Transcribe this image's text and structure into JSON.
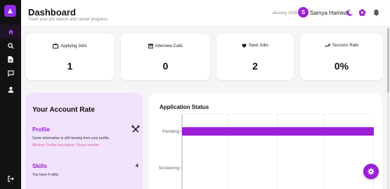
{
  "header": {
    "title": "Dashboard",
    "subtitle": "Track your job search and career progress",
    "date": "January 2026",
    "user_initial": "S",
    "user_name": "Samya Hamed"
  },
  "sidebar": {
    "icons": [
      "home-icon",
      "search-icon",
      "document-icon",
      "chat-icon",
      "user-icon",
      "logout-icon"
    ],
    "active": "home-icon"
  },
  "stats": [
    {
      "label": "Applying Jobs",
      "icon": "briefcase-icon",
      "value": "1"
    },
    {
      "label": "Interview Calls",
      "icon": "calendar-icon",
      "value": "0"
    },
    {
      "label": "Save Jobs",
      "icon": "heart-icon",
      "value": "2"
    },
    {
      "label": "Success Rate",
      "icon": "trend-up-icon",
      "value": "0%"
    }
  ],
  "account": {
    "title": "Your Account Rate",
    "profile_label": "Profile",
    "profile_text": "Some information is still missing from your profile.",
    "profile_missing": "Missing: Profile description, Phone number",
    "skills_label": "Skills",
    "skills_count": "4",
    "skills_text": "You have 4 skills."
  },
  "application_status": {
    "title": "Application Status"
  },
  "chart_data": {
    "type": "bar",
    "orientation": "horizontal",
    "title": "Application Status",
    "categories": [
      "Pending",
      "Screening"
    ],
    "values": [
      1,
      0
    ],
    "bar_color": "#9b1fd6",
    "grid": true
  },
  "colors": {
    "accent": "#9b1fd6",
    "account_bg": "#f1e3fc",
    "missing": "#e06191",
    "sidebar_bg": "#121212"
  }
}
